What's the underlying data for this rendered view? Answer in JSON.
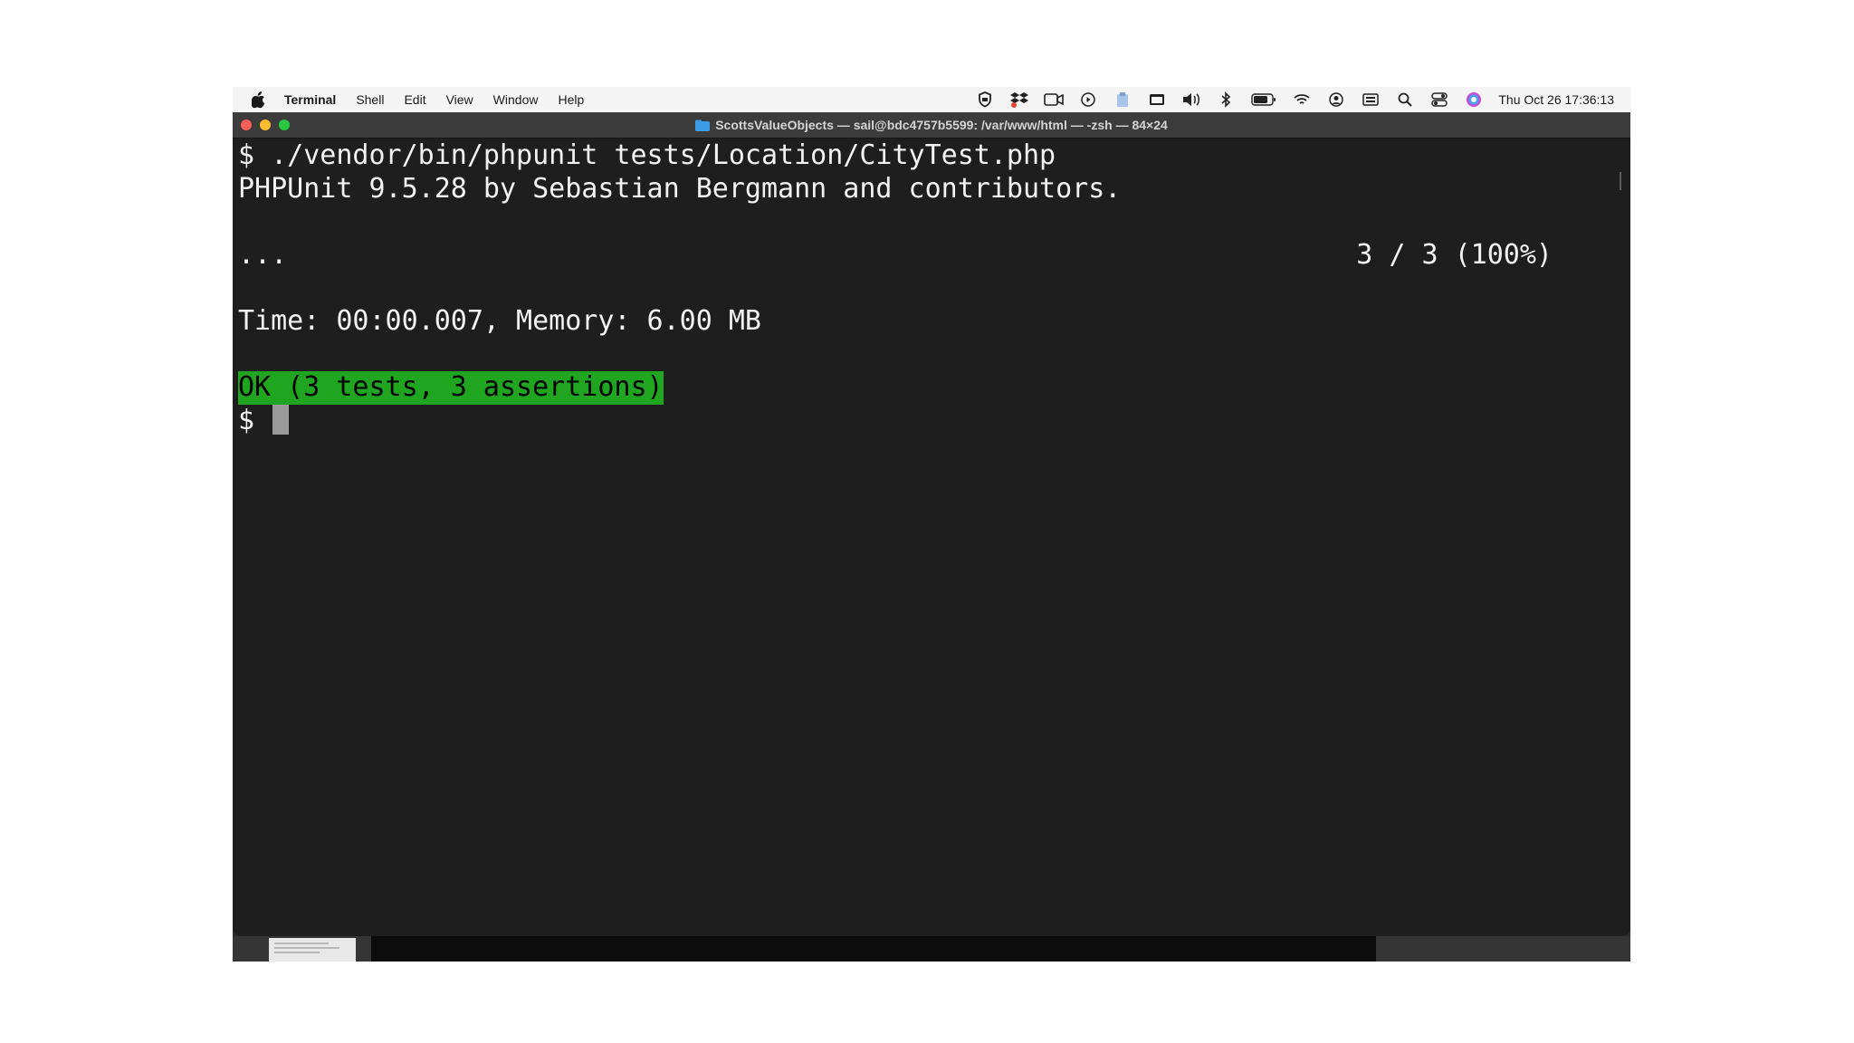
{
  "menubar": {
    "app_name": "Terminal",
    "items": [
      "Shell",
      "Edit",
      "View",
      "Window",
      "Help"
    ],
    "status_icons": [
      "shield-icon",
      "dropbox-icon",
      "video-camera-icon",
      "play-icon",
      "paste-icon",
      "window-icon",
      "volume-icon",
      "bluetooth-icon",
      "battery-icon",
      "wifi-icon",
      "user-icon",
      "keyboard-icon",
      "search-icon",
      "control-center-icon",
      "siri-icon"
    ],
    "clock": "Thu Oct 26  17:36:13"
  },
  "window": {
    "title": "ScottsValueObjects — sail@bdc4757b5599: /var/www/html — -zsh — 84×24"
  },
  "terminal": {
    "command": "$ ./vendor/bin/phpunit tests/Location/CityTest.php",
    "version_line": "PHPUnit 9.5.28 by Sebastian Bergmann and contributors.",
    "progress_dots": "...",
    "progress_count": "3 / 3 (100%)",
    "time_memory": "Time: 00:00.007, Memory: 6.00 MB",
    "ok_result": "OK (3 tests, 3 assertions)",
    "prompt": "$ "
  },
  "colors": {
    "terminal_bg": "#1e1e1e",
    "terminal_text": "#f2f2f2",
    "ok_highlight": "#1fa51f"
  }
}
